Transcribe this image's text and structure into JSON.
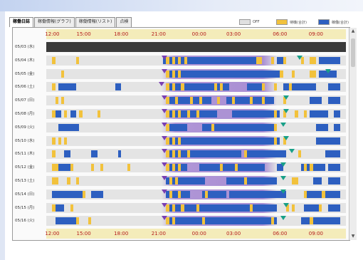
{
  "tabs": [
    {
      "label": "稼働日誌",
      "active": true
    },
    {
      "label": "稼働情報(グラフ)",
      "active": false
    },
    {
      "label": "稼働情報(リスト)",
      "active": false
    },
    {
      "label": "点検",
      "active": false
    }
  ],
  "legend": [
    {
      "label": "OFF",
      "key": "off"
    },
    {
      "label": "待機(合計)",
      "key": "standby"
    },
    {
      "label": "稼働(合計)",
      "key": "work"
    }
  ],
  "hour_labels": [
    "12:00",
    "15:00",
    "18:00",
    "21:00",
    "00:00",
    "03:00",
    "06:00",
    "09:00"
  ],
  "rows": [
    {
      "date": "05/03 (水)",
      "night": null,
      "work": [],
      "standby": [],
      "black": [
        [
          0,
          100
        ]
      ],
      "pins": []
    },
    {
      "date": "05/04 (木)",
      "night": [
        38.5,
        77
      ],
      "work": [
        [
          39,
          70
        ],
        [
          77,
          80
        ],
        [
          91,
          98
        ]
      ],
      "standby": [
        [
          2,
          3
        ],
        [
          10,
          11
        ],
        [
          40,
          41
        ],
        [
          42,
          43
        ],
        [
          44,
          45
        ],
        [
          46,
          47
        ],
        [
          70,
          72
        ],
        [
          75,
          76
        ],
        [
          79,
          80
        ],
        [
          85,
          86
        ],
        [
          88,
          90
        ]
      ],
      "black": [],
      "pins": [
        {
          "at": 39.5,
          "color": "violet"
        },
        {
          "at": 84.5,
          "color": "teal"
        }
      ]
    },
    {
      "date": "05/05 (金)",
      "night": [
        38.5,
        77
      ],
      "work": [
        [
          40,
          79
        ],
        [
          91,
          97
        ]
      ],
      "standby": [
        [
          5,
          6
        ],
        [
          40,
          41
        ],
        [
          42,
          43
        ],
        [
          44,
          45
        ],
        [
          78,
          79
        ],
        [
          82,
          83
        ],
        [
          88,
          90
        ]
      ],
      "black": [],
      "pins": [
        {
          "at": 39.5,
          "color": "violet"
        },
        {
          "at": 94,
          "color": "teal"
        }
      ]
    },
    {
      "date": "05/06 (土)",
      "night": [
        38.5,
        77
      ],
      "work": [
        [
          4,
          10
        ],
        [
          23,
          25
        ],
        [
          40,
          61
        ],
        [
          67,
          72
        ],
        [
          79,
          90
        ],
        [
          94,
          98
        ]
      ],
      "standby": [
        [
          2,
          3
        ],
        [
          40,
          41
        ],
        [
          42,
          43
        ],
        [
          45,
          46
        ],
        [
          56,
          57
        ],
        [
          58,
          59
        ],
        [
          72,
          73
        ],
        [
          76,
          77
        ],
        [
          81,
          82
        ]
      ],
      "black": [],
      "pins": [
        {
          "at": 38.5,
          "color": "violet"
        }
      ]
    },
    {
      "date": "05/07 (日)",
      "night": [
        38.5,
        77
      ],
      "work": [
        [
          40,
          55
        ],
        [
          60,
          76
        ],
        [
          88,
          92
        ],
        [
          94,
          98
        ]
      ],
      "standby": [
        [
          3,
          4
        ],
        [
          5,
          6
        ],
        [
          40,
          41
        ],
        [
          43,
          44
        ],
        [
          48,
          49
        ],
        [
          51,
          52
        ],
        [
          57,
          58
        ],
        [
          62,
          63
        ],
        [
          68,
          69
        ],
        [
          72,
          73
        ],
        [
          79,
          80
        ]
      ],
      "black": [],
      "pins": [
        {
          "at": 39.5,
          "color": "violet"
        },
        {
          "at": 80,
          "color": "teal"
        }
      ]
    },
    {
      "date": "05/08 (月)",
      "night": [
        38.5,
        77
      ],
      "work": [
        [
          3,
          5
        ],
        [
          8,
          10
        ],
        [
          40,
          57
        ],
        [
          62,
          78
        ],
        [
          88,
          94
        ],
        [
          96,
          98
        ]
      ],
      "standby": [
        [
          2,
          3
        ],
        [
          6,
          7
        ],
        [
          11,
          12
        ],
        [
          17,
          18
        ],
        [
          40,
          41
        ],
        [
          42,
          43
        ],
        [
          44,
          45
        ],
        [
          47,
          48
        ],
        [
          50,
          51
        ],
        [
          76,
          77
        ],
        [
          79,
          80
        ],
        [
          83,
          84
        ],
        [
          86,
          87
        ]
      ],
      "black": [],
      "pins": [
        {
          "at": 39.5,
          "color": "violet"
        },
        {
          "at": 80,
          "color": "teal"
        }
      ]
    },
    {
      "date": "05/09 (火)",
      "night": [
        38.5,
        77
      ],
      "work": [
        [
          4,
          11
        ],
        [
          40,
          47
        ],
        [
          52,
          77
        ],
        [
          90,
          94
        ],
        [
          96,
          98
        ]
      ],
      "standby": [
        [
          40,
          41
        ],
        [
          55,
          56
        ],
        [
          76,
          77
        ]
      ],
      "black": [],
      "pins": [
        {
          "at": 39.5,
          "color": "violet"
        },
        {
          "at": 79,
          "color": "teal"
        }
      ]
    },
    {
      "date": "05/10 (水)",
      "night": [
        38.5,
        77
      ],
      "work": [
        [
          40,
          78
        ],
        [
          90,
          98
        ]
      ],
      "standby": [
        [
          2,
          3
        ],
        [
          4,
          5
        ],
        [
          6,
          7
        ],
        [
          40,
          41
        ],
        [
          42,
          43
        ],
        [
          44,
          45
        ],
        [
          76,
          77
        ],
        [
          79,
          80
        ]
      ],
      "black": [],
      "pins": [
        {
          "at": 39.5,
          "color": "violet"
        },
        {
          "at": 80,
          "color": "teal"
        }
      ]
    },
    {
      "date": "05/11 (木)",
      "night": [
        38.5,
        77
      ],
      "work": [
        [
          6,
          8
        ],
        [
          15,
          17
        ],
        [
          24,
          25
        ],
        [
          40,
          65
        ],
        [
          67,
          80
        ],
        [
          93,
          98
        ]
      ],
      "standby": [
        [
          2,
          3
        ],
        [
          40,
          41
        ],
        [
          42,
          43
        ],
        [
          44,
          45
        ],
        [
          47,
          48
        ],
        [
          66,
          67
        ],
        [
          84,
          85
        ]
      ],
      "black": [],
      "pins": [
        {
          "at": 39.5,
          "color": "violet"
        },
        {
          "at": 82,
          "color": "teal"
        }
      ]
    },
    {
      "date": "05/12 (金)",
      "night": [
        38.5,
        77
      ],
      "work": [
        [
          4,
          9
        ],
        [
          40,
          47
        ],
        [
          51,
          73
        ],
        [
          77,
          79
        ],
        [
          85,
          93
        ],
        [
          94,
          98
        ]
      ],
      "standby": [
        [
          2,
          3
        ],
        [
          3,
          4
        ],
        [
          8,
          9
        ],
        [
          15,
          16
        ],
        [
          18,
          19
        ],
        [
          27,
          28
        ],
        [
          40,
          41
        ],
        [
          42,
          43
        ],
        [
          44,
          45
        ],
        [
          58,
          59
        ],
        [
          63,
          64
        ],
        [
          86,
          87
        ],
        [
          88,
          89
        ]
      ],
      "black": [],
      "pins": [
        {
          "at": 39.5,
          "color": "violet"
        },
        {
          "at": 79,
          "color": "teal"
        }
      ]
    },
    {
      "date": "05/13 (土)",
      "night": [
        38.5,
        77
      ],
      "work": [
        [
          40,
          53
        ],
        [
          60,
          77
        ],
        [
          89,
          92
        ],
        [
          94,
          98
        ]
      ],
      "standby": [
        [
          2,
          3
        ],
        [
          3,
          4
        ],
        [
          7,
          8
        ],
        [
          10,
          11
        ],
        [
          41,
          42
        ],
        [
          43,
          44
        ],
        [
          66,
          67
        ],
        [
          82,
          83
        ],
        [
          83,
          84
        ]
      ],
      "black": [],
      "pins": [
        {
          "at": 39.5,
          "color": "violet"
        },
        {
          "at": 79,
          "color": "teal"
        }
      ]
    },
    {
      "date": "05/14 (日)",
      "night": [
        38.5,
        77
      ],
      "work": [
        [
          2,
          4
        ],
        [
          4,
          12
        ],
        [
          15,
          19
        ],
        [
          40,
          48
        ],
        [
          52,
          60
        ],
        [
          61,
          80
        ],
        [
          86,
          98
        ]
      ],
      "standby": [
        [
          12,
          13
        ],
        [
          41,
          42
        ],
        [
          44,
          45
        ],
        [
          53,
          54
        ],
        [
          86,
          87
        ],
        [
          92,
          93
        ]
      ],
      "black": [],
      "pins": [
        {
          "at": 39.5,
          "color": "violet"
        },
        {
          "at": 79,
          "color": "teal"
        }
      ]
    },
    {
      "date": "05/15 (月)",
      "night": [
        38.5,
        77
      ],
      "work": [
        [
          3,
          6
        ],
        [
          40,
          77
        ],
        [
          86,
          91
        ],
        [
          94,
          98
        ]
      ],
      "standby": [
        [
          2,
          3
        ],
        [
          8,
          9
        ],
        [
          40,
          41
        ],
        [
          42,
          43
        ],
        [
          45,
          46
        ],
        [
          50,
          51
        ],
        [
          68,
          69
        ],
        [
          80,
          81
        ],
        [
          82,
          83
        ],
        [
          91,
          92
        ]
      ],
      "black": [],
      "pins": [
        {
          "at": 39.5,
          "color": "violet"
        },
        {
          "at": 80,
          "color": "teal"
        }
      ]
    },
    {
      "date": "05/16 (火)",
      "night": [
        38.5,
        77
      ],
      "work": [
        [
          3,
          11
        ],
        [
          40,
          77
        ],
        [
          85,
          98
        ]
      ],
      "standby": [
        [
          10,
          11
        ],
        [
          14,
          15
        ],
        [
          40,
          41
        ],
        [
          42,
          43
        ],
        [
          52,
          53
        ],
        [
          75,
          76
        ],
        [
          88,
          89
        ]
      ],
      "black": [],
      "pins": [
        {
          "at": 39.5,
          "color": "violet"
        },
        {
          "at": 79,
          "color": "teal"
        }
      ]
    }
  ]
}
